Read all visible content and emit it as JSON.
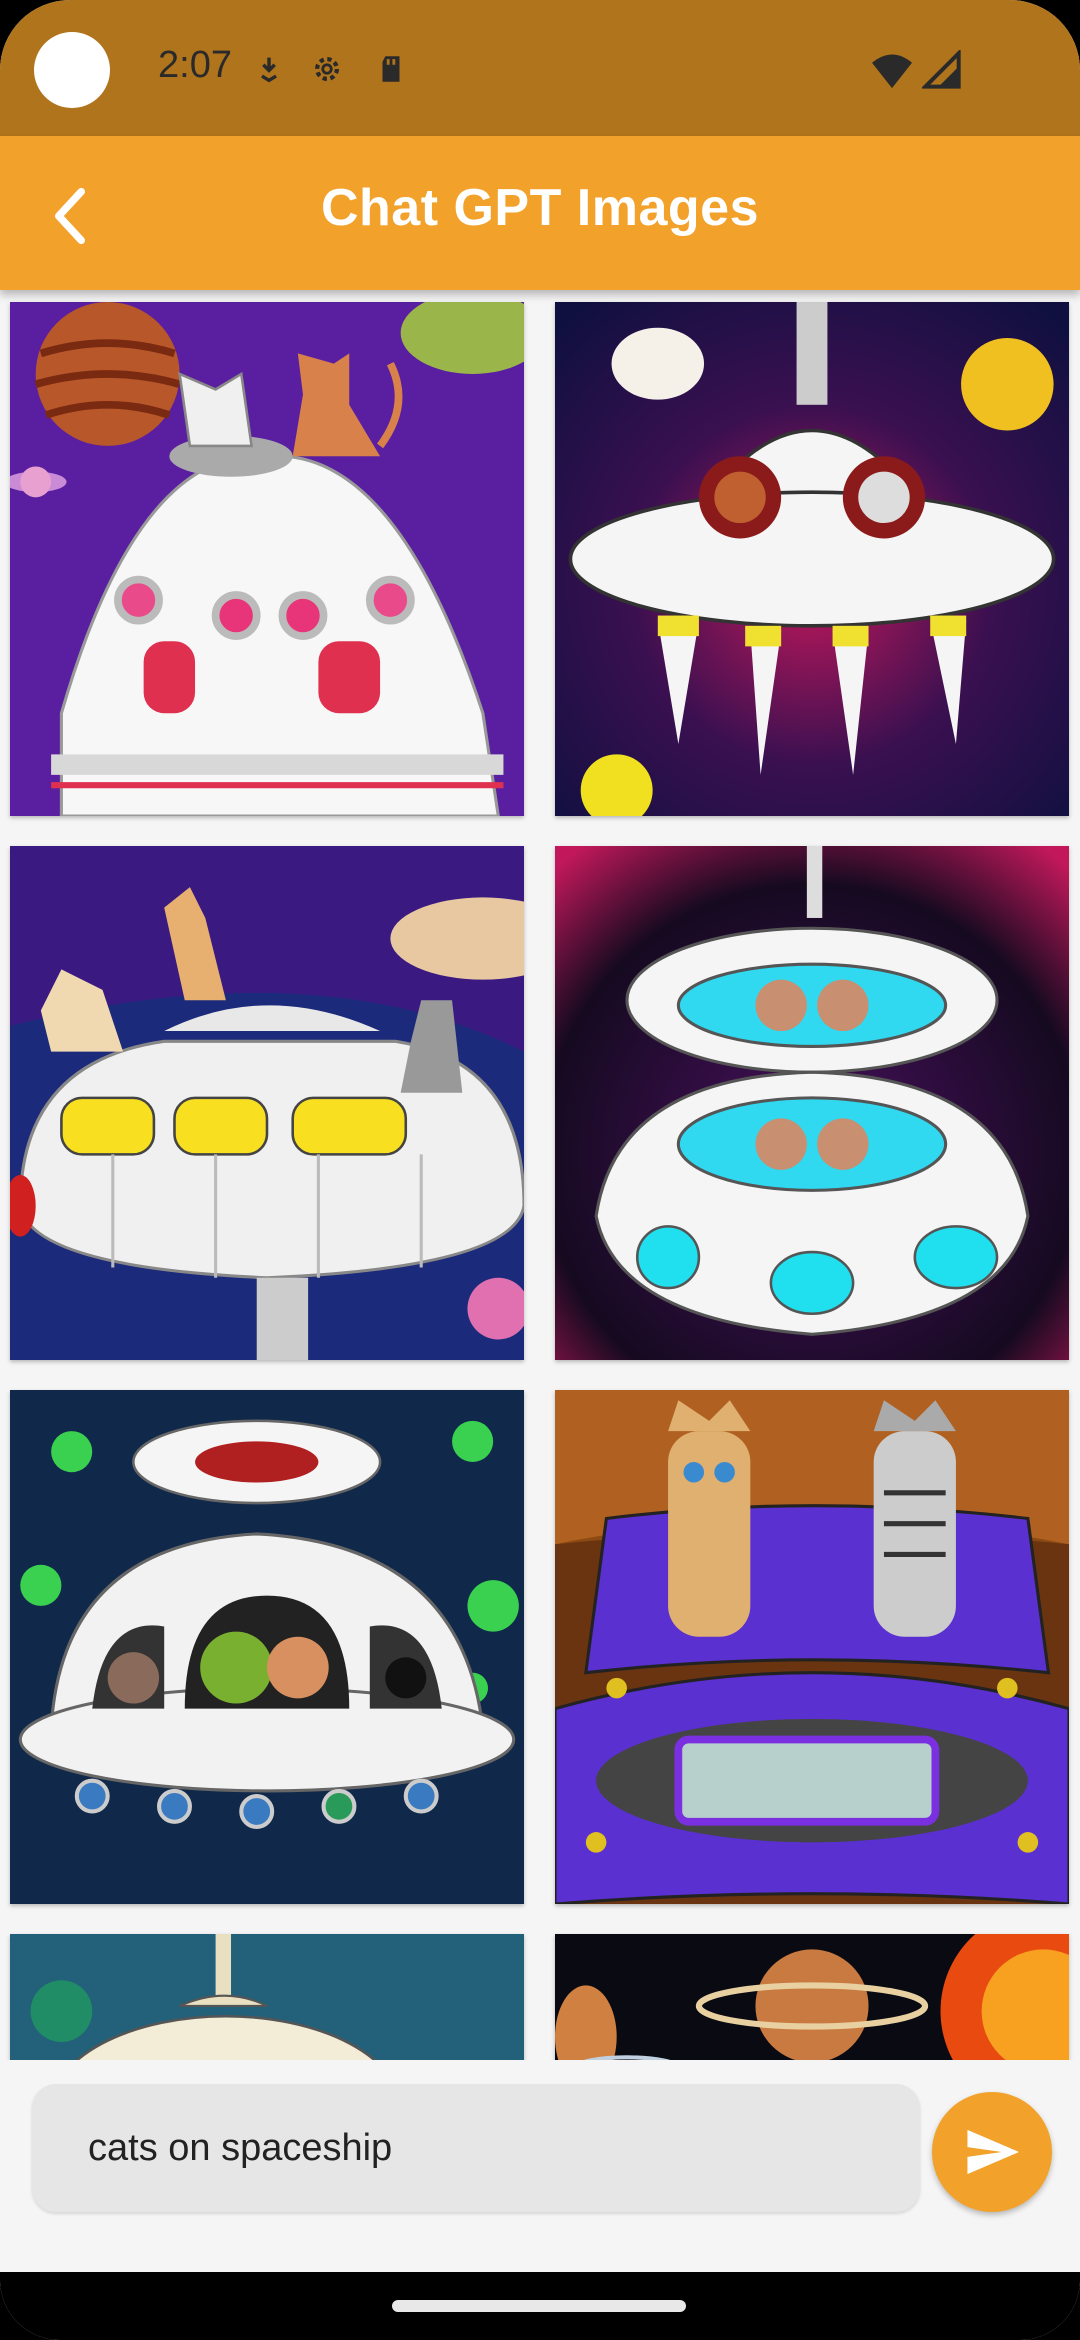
{
  "status_bar": {
    "time": "2:07",
    "icons_left": [
      "camera-cutout-icon",
      "download-icon",
      "settings-icon",
      "sd-card-icon"
    ],
    "icons_right": [
      "wifi-icon",
      "cell-signal-icon"
    ]
  },
  "app_bar": {
    "title": "Chat GPT Images",
    "back_icon": "chevron-left-icon"
  },
  "colors": {
    "status_bar": "#b0741c",
    "app_bar": "#f2a12a",
    "send_button": "#f2a12a"
  },
  "images": [
    {
      "subject": "white cats on spaceship, purple sky"
    },
    {
      "subject": "flying saucer with cats in portholes"
    },
    {
      "subject": "cats riding bus-like spaceship"
    },
    {
      "subject": "two-deck saucer with four cats"
    },
    {
      "subject": "saucer with cats and green alien"
    },
    {
      "subject": "tabby cats in purple spaceship"
    },
    {
      "subject": "saucer over green nebula"
    },
    {
      "subject": "planets and sun"
    }
  ],
  "prompt_input": {
    "value": "cats on spaceship"
  },
  "send_button": {
    "icon": "send-icon"
  }
}
